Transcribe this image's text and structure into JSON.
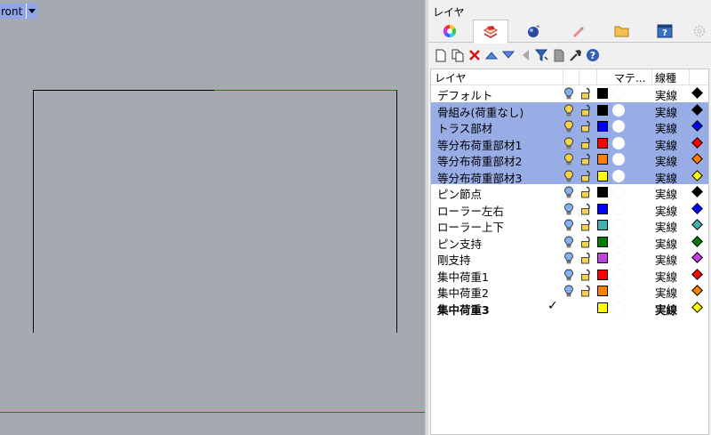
{
  "viewport": {
    "name": "ront"
  },
  "panel": {
    "title": "レイヤ",
    "tabs": [
      {
        "icon": "color-wheel-icon"
      },
      {
        "icon": "layers-icon",
        "active": true
      },
      {
        "icon": "material-sphere-icon"
      },
      {
        "icon": "light-icon"
      },
      {
        "icon": "folder-icon"
      },
      {
        "icon": "help-window-icon"
      },
      {
        "icon": "settings-gear-icon"
      }
    ],
    "toolbar": [
      "new-layer-icon",
      "new-sublayer-icon",
      "delete-icon",
      "move-up-icon",
      "move-down-icon",
      "move-left-icon",
      "filter-icon",
      "document-icon",
      "tools-icon",
      "help-icon"
    ],
    "columns": {
      "layer": "レイヤ",
      "material": "マテ...",
      "linetype": "線種"
    },
    "layers": [
      {
        "name": "デフォルト",
        "color": "#000000",
        "linetype": "実線",
        "selected": false,
        "current": false,
        "mat": "none"
      },
      {
        "name": "骨組み(荷重なし)",
        "color": "#000000",
        "linetype": "実線",
        "selected": true,
        "current": false,
        "mat": "white"
      },
      {
        "name": "トラス部材",
        "color": "#0000ff",
        "linetype": "実線",
        "selected": true,
        "current": false,
        "mat": "white"
      },
      {
        "name": "等分布荷重部材1",
        "color": "#ff0000",
        "linetype": "実線",
        "selected": true,
        "current": false,
        "mat": "white"
      },
      {
        "name": "等分布荷重部材2",
        "color": "#ff8000",
        "linetype": "実線",
        "selected": true,
        "current": false,
        "mat": "white"
      },
      {
        "name": "等分布荷重部材3",
        "color": "#ffff00",
        "linetype": "実線",
        "selected": true,
        "current": false,
        "mat": "white"
      },
      {
        "name": "ピン節点",
        "color": "#000000",
        "linetype": "実線",
        "selected": false,
        "current": false,
        "mat": "none"
      },
      {
        "name": "ローラー左右",
        "color": "#0000ff",
        "linetype": "実線",
        "selected": false,
        "current": false,
        "mat": "none"
      },
      {
        "name": "ローラー上下",
        "color": "#40b0b0",
        "linetype": "実線",
        "selected": false,
        "current": false,
        "mat": "none"
      },
      {
        "name": "ピン支持",
        "color": "#008000",
        "linetype": "実線",
        "selected": false,
        "current": false,
        "mat": "none"
      },
      {
        "name": "剛支持",
        "color": "#c040e0",
        "linetype": "実線",
        "selected": false,
        "current": false,
        "mat": "none"
      },
      {
        "name": "集中荷重1",
        "color": "#ff0000",
        "linetype": "実線",
        "selected": false,
        "current": false,
        "mat": "none"
      },
      {
        "name": "集中荷重2",
        "color": "#ff8000",
        "linetype": "実線",
        "selected": false,
        "current": false,
        "mat": "none"
      },
      {
        "name": "集中荷重3",
        "color": "#ffff00",
        "linetype": "実線",
        "selected": false,
        "current": true,
        "mat": "none"
      }
    ]
  }
}
